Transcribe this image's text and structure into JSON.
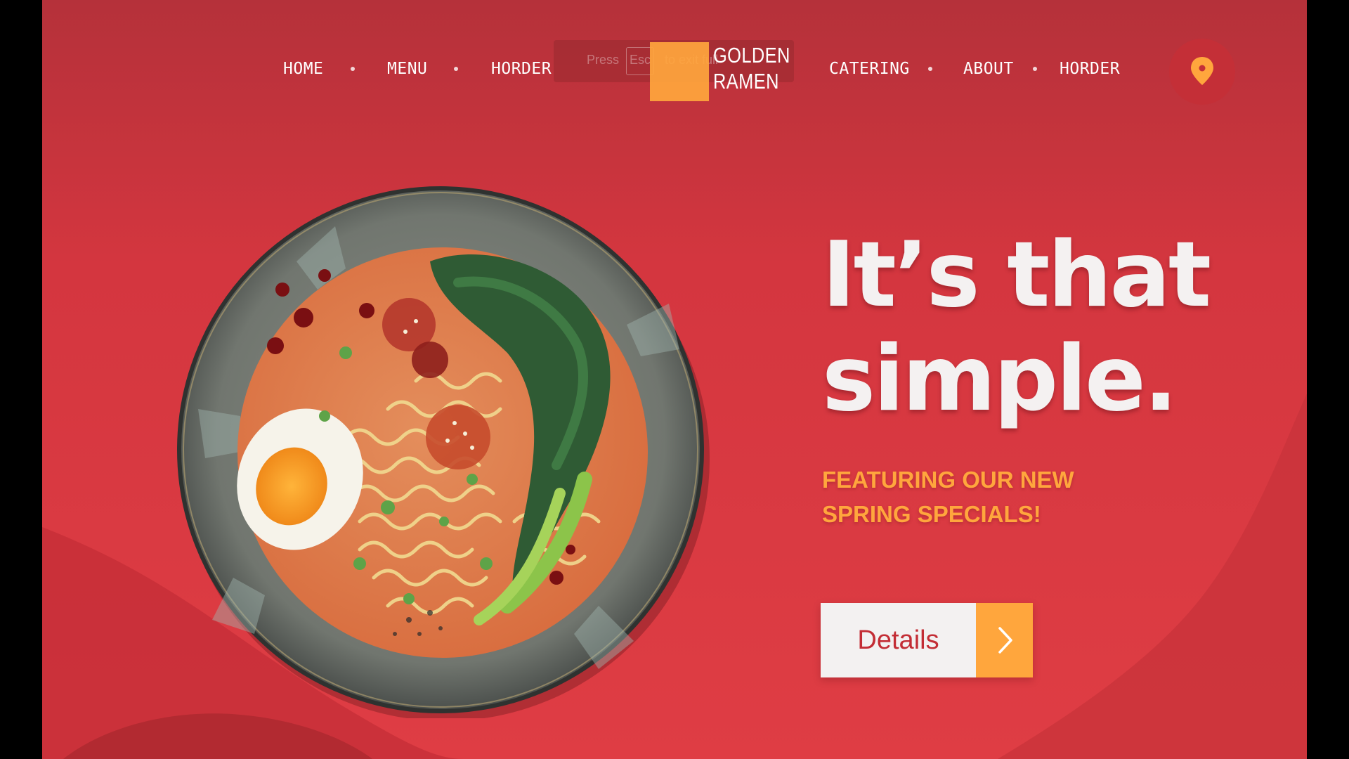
{
  "nav": {
    "left": [
      "HOME",
      "MENU",
      "HORDER"
    ],
    "right": [
      "CATERING",
      "ABOUT",
      "HORDER"
    ]
  },
  "logo": {
    "line1": "GOLDEN",
    "line2": "RAMEN"
  },
  "fullscreen_hint": {
    "press": "Press",
    "key": "Esc",
    "rest": "to exit full"
  },
  "location_button": {
    "icon": "map-pin-icon"
  },
  "hero": {
    "headline_line1": "It’s that",
    "headline_line2": "simple.",
    "subhead_line1": "FEATURING OUR NEW",
    "subhead_line2": "SPRING SPECIALS!",
    "cta_label": "Details",
    "cta_icon": "chevron-right-icon"
  },
  "image": {
    "name": "ramen-bowl-image"
  },
  "colors": {
    "background_red": "#d4363f",
    "accent_orange": "#ffa63d",
    "text_light": "#f4f1f1",
    "button_text_red": "#c32d35"
  }
}
